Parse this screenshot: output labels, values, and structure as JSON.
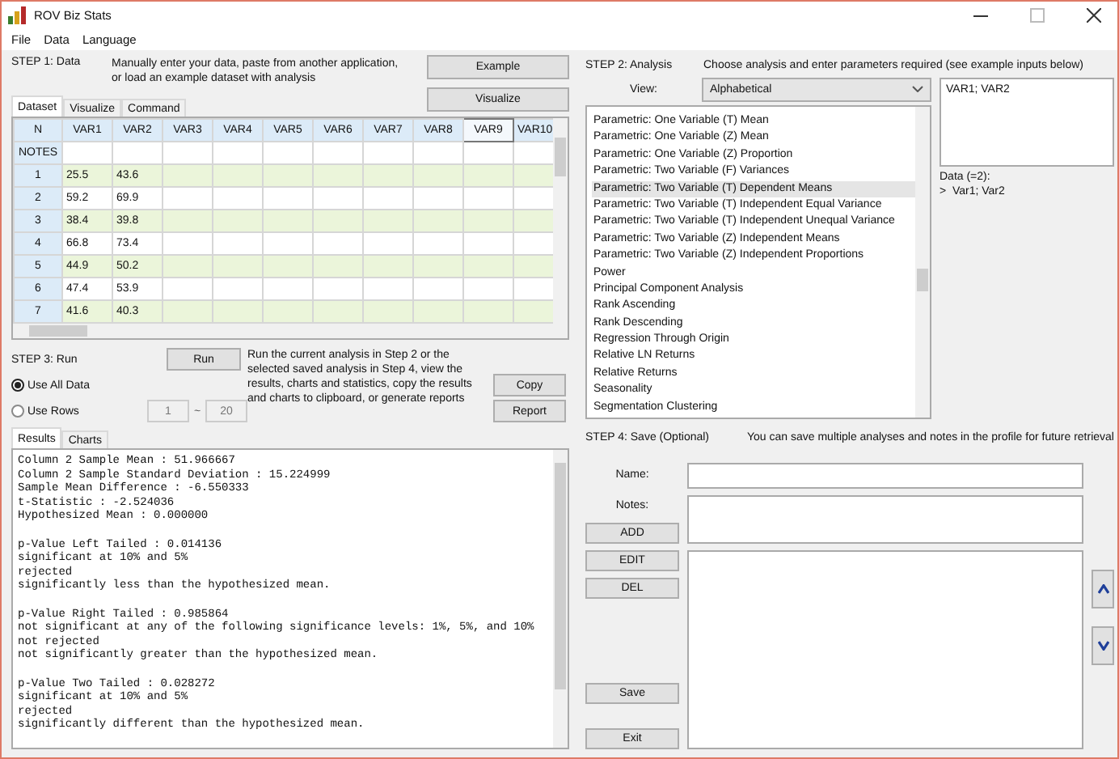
{
  "window": {
    "title": "ROV Biz Stats"
  },
  "menu": [
    "File",
    "Data",
    "Language"
  ],
  "step1": {
    "label": "STEP 1: Data",
    "description": "Manually enter your data, paste from another application, or load an example dataset with analysis",
    "buttons": [
      "Example",
      "Visualize"
    ]
  },
  "data_tabs": [
    {
      "label": "Dataset",
      "selected": true
    },
    {
      "label": "Visualize",
      "selected": false
    },
    {
      "label": "Command",
      "selected": false
    }
  ],
  "grid": {
    "columns": [
      {
        "label": "N",
        "selected": false
      },
      {
        "label": "VAR1",
        "selected": false
      },
      {
        "label": "VAR2",
        "selected": false
      },
      {
        "label": "VAR3",
        "selected": false
      },
      {
        "label": "VAR4",
        "selected": false
      },
      {
        "label": "VAR5",
        "selected": false
      },
      {
        "label": "VAR6",
        "selected": false
      },
      {
        "label": "VAR7",
        "selected": false
      },
      {
        "label": "VAR8",
        "selected": false
      },
      {
        "label": "VAR9",
        "selected": true
      },
      {
        "label": "VAR10",
        "selected": false
      }
    ],
    "rows": [
      {
        "label": "NOTES"
      },
      {
        "label": "1",
        "values": [
          "25.5",
          "43.6"
        ]
      },
      {
        "label": "2",
        "values": [
          "59.2",
          "69.9"
        ]
      },
      {
        "label": "3",
        "values": [
          "38.4",
          "39.8"
        ]
      },
      {
        "label": "4",
        "values": [
          "66.8",
          "73.4"
        ]
      },
      {
        "label": "5",
        "values": [
          "44.9",
          "50.2"
        ]
      },
      {
        "label": "6",
        "values": [
          "47.4",
          "53.9"
        ]
      },
      {
        "label": "7",
        "values": [
          "41.6",
          "40.3"
        ]
      }
    ]
  },
  "step3": {
    "label": "STEP 3: Run",
    "run_button": "Run",
    "description": "Run the current analysis in Step 2 or the selected saved analysis in Step 4, view the results, charts and statistics, copy the results and charts to clipboard, or generate reports",
    "buttons": [
      "Copy",
      "Report"
    ],
    "row_options": [
      {
        "label": "Use All Data",
        "selected": true
      },
      {
        "label": "Use Rows",
        "selected": false
      }
    ],
    "row_from": "1",
    "range_separator": "~",
    "row_to": "20"
  },
  "results_tabs": [
    {
      "label": "Results",
      "selected": true
    },
    {
      "label": "Charts",
      "selected": false
    }
  ],
  "results": {
    "paragraphs": [
      [
        "Column 2 Sample Mean : 51.966667",
        "Column 2 Sample Standard Deviation : 15.224999",
        "Sample Mean Difference : -6.550333",
        "t-Statistic : -2.524036",
        "Hypothesized Mean : 0.000000"
      ],
      [
        "p-Value Left Tailed : 0.014136",
        "significant at 10% and 5%",
        "rejected",
        "significantly less than the hypothesized mean."
      ],
      [
        "p-Value Right Tailed : 0.985864",
        "not significant at any of the following significance levels: 1%, 5%, and 10%",
        "not rejected",
        "not significantly greater than the hypothesized mean."
      ],
      [
        "p-Value Two Tailed : 0.028272",
        "significant at 10% and 5%",
        "rejected",
        "significantly different than the hypothesized mean."
      ]
    ]
  },
  "step2": {
    "label": "STEP 2: Analysis",
    "description": "Choose analysis and enter parameters required (see example inputs below)",
    "view_label": "View:",
    "view_value": "Alphabetical",
    "analyses": [
      {
        "label": "Parametric: One Variable (T) Mean",
        "selected": false
      },
      {
        "label": "Parametric: One Variable (Z) Mean",
        "selected": false
      },
      {
        "label": "Parametric: One Variable (Z) Proportion",
        "selected": false
      },
      {
        "label": "Parametric: Two Variable (F) Variances",
        "selected": false
      },
      {
        "label": "Parametric: Two Variable (T) Dependent Means",
        "selected": true
      },
      {
        "label": "Parametric: Two Variable (T) Independent Equal Variance",
        "selected": false
      },
      {
        "label": "Parametric: Two Variable (T) Independent Unequal Variance",
        "selected": false
      },
      {
        "label": "Parametric: Two Variable (Z) Independent Means",
        "selected": false
      },
      {
        "label": "Parametric: Two Variable (Z) Independent Proportions",
        "selected": false
      },
      {
        "label": "Power",
        "selected": false
      },
      {
        "label": "Principal Component Analysis",
        "selected": false
      },
      {
        "label": "Rank Ascending",
        "selected": false
      },
      {
        "label": "Rank Descending",
        "selected": false
      },
      {
        "label": "Regression Through Origin",
        "selected": false
      },
      {
        "label": "Relative LN Returns",
        "selected": false
      },
      {
        "label": "Relative Returns",
        "selected": false
      },
      {
        "label": "Seasonality",
        "selected": false
      },
      {
        "label": "Segmentation Clustering",
        "selected": false
      }
    ],
    "parameters": "VAR1; VAR2",
    "data_hint": "Data (=2):",
    "data_example": ">  Var1; Var2"
  },
  "step4": {
    "label": "STEP 4: Save (Optional)",
    "description": "You can save multiple analyses and notes in the profile for future retrieval",
    "name_label": "Name:",
    "notes_label": "Notes:",
    "edit_buttons": [
      "ADD",
      "EDIT",
      "DEL"
    ],
    "file_buttons": [
      "Save",
      "Exit"
    ]
  }
}
